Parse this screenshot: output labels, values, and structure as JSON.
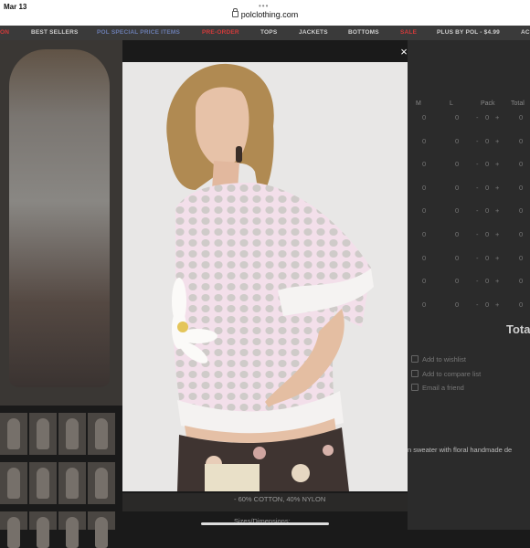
{
  "status": {
    "time": "Mar 13",
    "url": "polclothing.com"
  },
  "nav": {
    "items": [
      {
        "label": "ON",
        "color": "#d23a3a"
      },
      {
        "label": "BEST SELLERS",
        "color": "#cfcfcf"
      },
      {
        "label": "POL SPECIAL PRICE ITEMS",
        "color": "#6a7cb0"
      },
      {
        "label": "PRE-ORDER",
        "color": "#d23a3a"
      },
      {
        "label": "TOPS",
        "color": "#cfcfcf"
      },
      {
        "label": "JACKETS",
        "color": "#cfcfcf"
      },
      {
        "label": "BOTTOMS",
        "color": "#cfcfcf"
      },
      {
        "label": "SALE",
        "color": "#d23a3a"
      },
      {
        "label": "PLUS BY POL - $4.99",
        "color": "#cfcfcf"
      },
      {
        "label": "AC",
        "color": "#cfcfcf"
      }
    ]
  },
  "order_table": {
    "headers": [
      "M",
      "L",
      "Pack",
      "Total"
    ],
    "rows": 9,
    "zero": "0",
    "minus": "-",
    "plus": "+",
    "total_label": "Tota"
  },
  "links": [
    "Add to wishlist",
    "Add to compare list",
    "Email a friend"
  ],
  "description": "n sweater with floral handmade de",
  "materials": "- 60% COTTON, 40% NYLON",
  "sizes_label": "Sizes/Dimensions:",
  "modal": {
    "close_label": "×"
  }
}
